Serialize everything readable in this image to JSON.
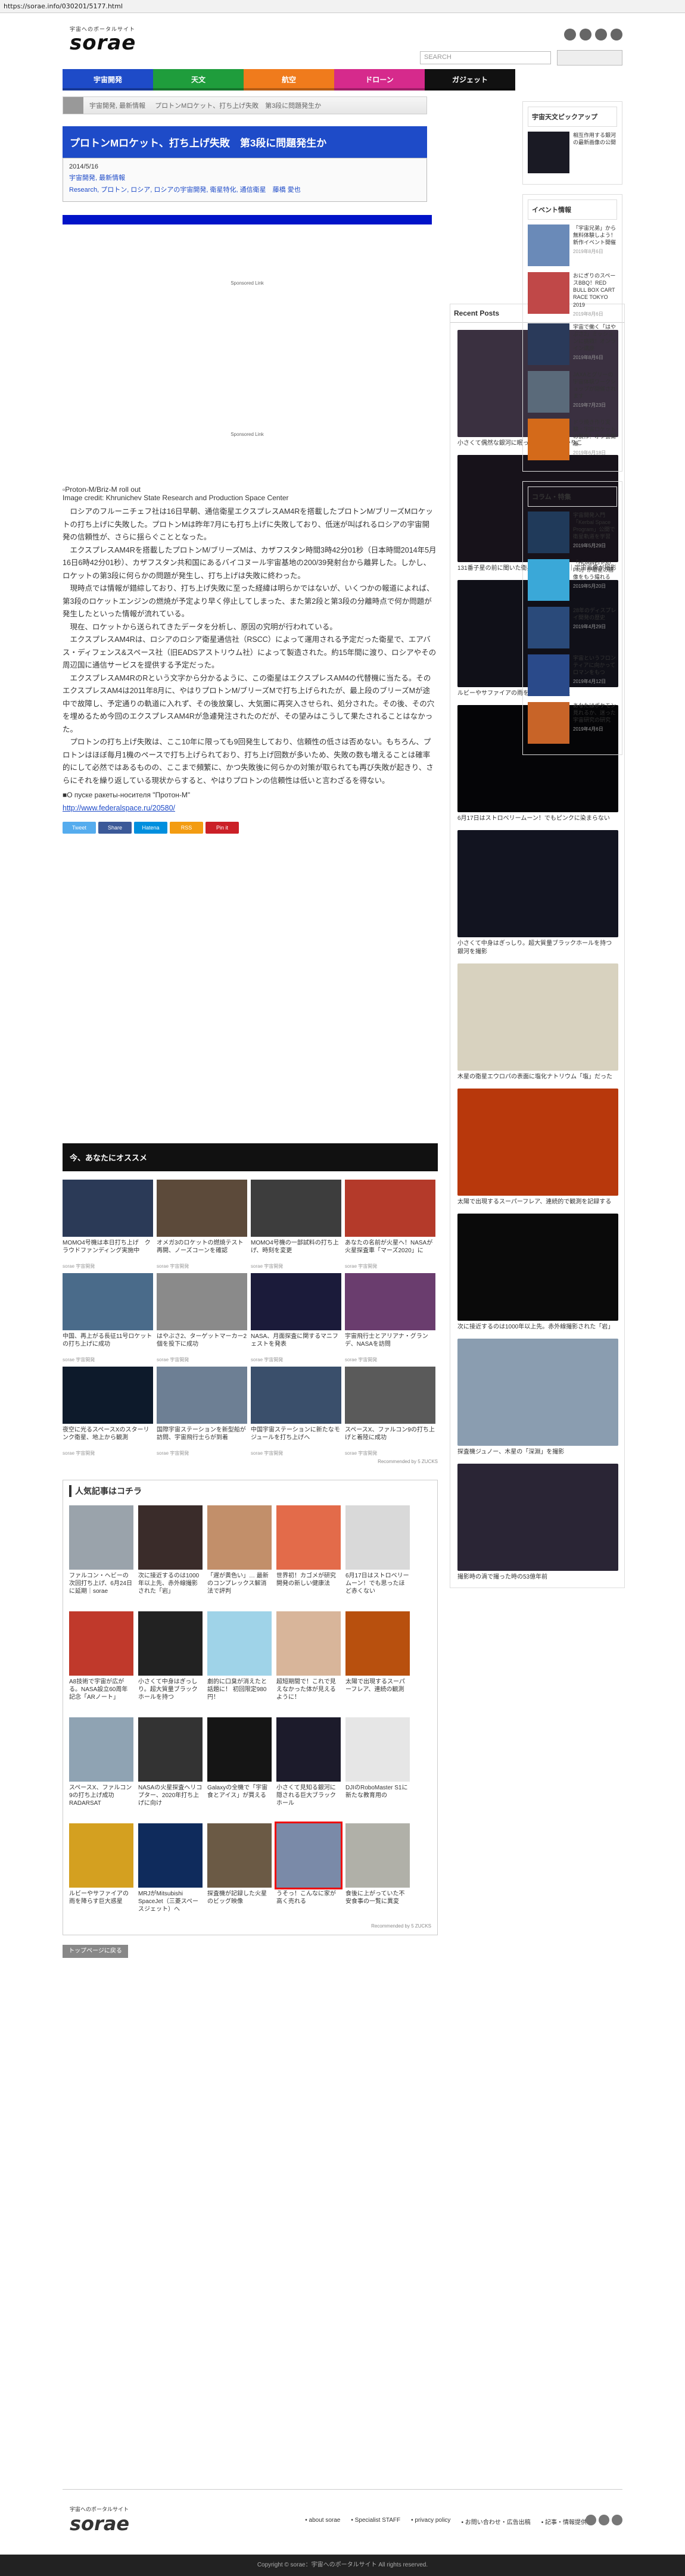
{
  "url": "https://sorae.info/030201/5177.html",
  "header": {
    "logo_sub": "宇宙へのポータルサイト",
    "logo": "sorae",
    "search_placeholder": "SEARCH"
  },
  "nav": [
    {
      "label": "宇宙開発",
      "color": "#1e4bc8"
    },
    {
      "label": "天文",
      "color": "#1f9d3c"
    },
    {
      "label": "航空",
      "color": "#f07b1c"
    },
    {
      "label": "ドローン",
      "color": "#d62a8c"
    },
    {
      "label": "ガジェット",
      "color": "#111111"
    }
  ],
  "breadcrumb": [
    "宇宙開発, 最新情報",
    "プロトンMロケット、打ち上げ失敗　第3段に問題発生か"
  ],
  "article": {
    "title": "プロトンMロケット、打ち上げ失敗　第3段に問題発生か",
    "date": "2014/5/16",
    "category_label": "",
    "categories": "宇宙開発, 最新情報",
    "tags": "Research, プロトン, ロシア, ロシアの宇宙開発, 衛星特化, 通信衛星",
    "author": "藤橋 愛也",
    "sponsored": "Sponsored Link",
    "image_alt": "Proton-M/Briz-M roll out",
    "credit": "Image credit: Khrunichev State Research and Production Space Center",
    "paragraphs": [
      "ロシアのフルーニチェフ社は16日早朝、通信衛星エクスプレスAM4Rを搭載したプロトンM/ブリーズMロケットの打ち上げに失敗した。プロトンMは昨年7月にも打ち上げに失敗しており、低迷が叫ばれるロシアの宇宙開発の信頼性が、さらに揺らぐこととなった。",
      "エクスプレスAM4Rを搭載したプロトンM/ブリーズMは、カザフスタン時間3時42分01秒（日本時間2014年5月16日6時42分01秒）、カザフスタン共和国にあるバイコヌール宇宙基地の200/39発射台から離昇した。しかし、ロケットの第3段に何らかの問題が発生し、打ち上げは失敗に終わった。",
      "現時点では情報が錯綜しており、打ち上げ失敗に至った経緯は明らかではないが、いくつかの報道によれば、第3段のロケットエンジンの燃焼が予定より早く停止してしまった、また第2段と第3段の分離時点で何か問題が発生したといった情報が流れている。",
      "現在、ロケットから送られてきたデータを分析し、原因の究明が行われている。",
      "エクスプレスAM4Rは、ロシアのロシア衛星通信社（RSCC）によって運用される予定だった衛星で、エアバス・ディフェンス&スペース社（旧EADSアストリウム社）によって製造された。約15年間に渡り、ロシアやその周辺国に通信サービスを提供する予定だった。",
      "エクスプレスAM4RのRという文字から分かるように、この衛星はエクスプレスAM4の代替機に当たる。そのエクスプレスAM4は2011年8月に、やはりプロトンM/ブリーズMで打ち上げられたが、最上段のブリーズMが途中で故障し、予定通りの軌道に入れず、その後放棄し、大気圏に再突入させられ、処分された。その後、その穴を埋めるため今回のエクスプレスAM4Rが急遽発注されたのだが、その望みはこうして果たされることはなかった。",
      "プロトンの打ち上げ失敗は、ここ10年に限っても9回発生しており、信頼性の低さは否めない。もちろん、プロトンはほぼ毎月1機のペースで打ち上げられており、打ち上げ回数が多いため、失敗の数も増えることは確率的にして必然ではあるものの、ここまで頻繁に、かつ失敗後に何らかの対策が取られても再び失敗が起きり、さらにそれを繰り返している現状からすると、やはりプロトンの信頼性は低いと言わざるを得ない。"
    ],
    "russian_line": "■О пуске ракеты-носителя \"Протон-М\"",
    "source_url": "http://www.federalspace.ru/20580/"
  },
  "share": [
    {
      "label": "Tweet",
      "color": "#55acee"
    },
    {
      "label": "Share",
      "color": "#3b5998"
    },
    {
      "label": "Hatena",
      "color": "#008fde"
    },
    {
      "label": "RSS",
      "color": "#f39c12"
    },
    {
      "label": "Pin it",
      "color": "#cb2027"
    }
  ],
  "recommend": {
    "heading": "今、あなたにオススメ",
    "items": [
      {
        "title": "MOMO4号機は本日打ち上げ　クラウドファンディング実施中",
        "src": "sorae 宇宙開発",
        "color": "#2b3a57"
      },
      {
        "title": "オメガ3のロケットの燃焼テスト再開、ノーズコーンを確認",
        "src": "sorae 宇宙開発",
        "color": "#5c4a3a"
      },
      {
        "title": "MOMO4号機の一部試料の打ち上げ、時刻を変更",
        "src": "sorae 宇宙開発",
        "color": "#3d3d3d"
      },
      {
        "title": "あなたの名前が火星へ！NASAが火星探査車「マーズ2020」に",
        "src": "sorae 宇宙開発",
        "color": "#b43a2a"
      },
      {
        "title": "中国、再上がる長征11号ロケットの打ち上げに成功",
        "src": "sorae 宇宙開発",
        "color": "#4a6b8a"
      },
      {
        "title": "はやぶさ2、ターゲットマーカー2個を投下に成功",
        "src": "sorae 宇宙開発",
        "color": "#8a8a8a"
      },
      {
        "title": "NASA、月面探査に関するマニフェストを発表",
        "src": "sorae 宇宙開発",
        "color": "#1b1b3a"
      },
      {
        "title": "宇宙飛行士とアリアナ・グランデ、NASAを訪問",
        "src": "sorae 宇宙開発",
        "color": "#6a3d6e"
      },
      {
        "title": "夜空に光るスペースXのスターリンク衛星、地上から観測",
        "src": "sorae 宇宙開発",
        "color": "#0d1a2b"
      },
      {
        "title": "国際宇宙ステーションを新型船が訪問、宇宙飛行士らが到着",
        "src": "sorae 宇宙開発",
        "color": "#6d7f94"
      },
      {
        "title": "中国宇宙ステーションに新たなモジュールを打ち上げへ",
        "src": "sorae 宇宙開発",
        "color": "#3a4f6b"
      },
      {
        "title": "スペースX、ファルコン9の打ち上げと着陸に成功",
        "src": "sorae 宇宙開発",
        "color": "#5a5a5a"
      }
    ],
    "powered": "Recommended by 5 ZUCKS"
  },
  "popular": {
    "heading": "人気記事はコチラ",
    "items": [
      {
        "title": "ファルコン・ヘビーの次回打ち上げ、6月24日に延期｜sorae",
        "color": "#9aa3ab"
      },
      {
        "title": "次に接近するのは1000年以上先、赤外線撮影された「岩」",
        "color": "#3a2c2a"
      },
      {
        "title": "「遅が黄色い」… 最新のコンプレックス解消法で評判",
        "color": "#c28f6a"
      },
      {
        "title": "世界初！カゴメが研究開発の新しい健康法",
        "color": "#e36b4a"
      },
      {
        "title": "6月17日はストロベリームーン！でも思ったほど赤くない",
        "color": "#d9d9d9"
      },
      {
        "title": "A8技術で宇宙が広がる。NASA設立60周年記念「ARノート」",
        "color": "#c0392b"
      },
      {
        "title": "小さくて中身はぎっしり。超大質量ブラックホールを持つ",
        "color": "#222222"
      },
      {
        "title": "劇的に口臭が消えたと話題に！ 初回限定980円！",
        "color": "#9fd3e8"
      },
      {
        "title": "超短期間で！これで見えなかった体が見えるように！",
        "color": "#d8b59a"
      },
      {
        "title": "太陽で出現するスーパーフレア、連続の観測",
        "color": "#b8500e"
      },
      {
        "title": "スペースX、ファルコン9の打ち上げ成功 RADARSAT",
        "color": "#8fa3b3"
      },
      {
        "title": "NASAの火星探査ヘリコプター、2020年打ち上げに向け",
        "color": "#333333"
      },
      {
        "title": "Galaxyの全機で「宇宙食とアイス」が買える",
        "color": "#151515"
      },
      {
        "title": "小さくて見知る銀河に隠される巨大ブラックホール",
        "color": "#1c1b2b"
      },
      {
        "title": "DJIのRoboMaster S1に新たな教育用の",
        "color": "#e6e6e6"
      },
      {
        "title": "ルビーやサファイアの雨を降らす巨大惑星",
        "color": "#d4a020"
      },
      {
        "title": "MRJがMitsubishi SpaceJet（三菱スペースジェット）へ",
        "color": "#0f2b5c"
      },
      {
        "title": "探査機が記録した火星のビッグ映像",
        "color": "#6b5a45"
      },
      {
        "title": "うそっ！こんなに家が高く売れる",
        "color": "#7a8aa8",
        "highlight": true
      },
      {
        "title": "食後に上がっていた不安食事の一覧に異変",
        "color": "#b0b0a8"
      }
    ],
    "powered": "Recommended by 5 ZUCKS"
  },
  "back_to_top": "トップページに戻る",
  "recent": {
    "heading": "Recent Posts",
    "items": [
      {
        "title": "小さくて偶然な銀河に眠った月並みのひかりこ",
        "color": "#3a3040"
      },
      {
        "title": "131番子星の前に聞いた衛星の合成モデル｜宇宙画像が撮影",
        "color": "#17121a"
      },
      {
        "title": "ルビーやサファイアの雨を降らす巨大惑星",
        "color": "#101018"
      },
      {
        "title": "6月17日はストロベリームーン！でもピンクに染まらない",
        "color": "#050507"
      },
      {
        "title": "小さくて中身はぎっしり。超大質量ブラックホールを持つ銀河を撮影",
        "color": "#121420"
      },
      {
        "title": "木星の衛星エウロパの表面に塩化ナトリウム「塩」だった",
        "color": "#d8d2bf"
      },
      {
        "title": "太陽で出現するスーパーフレア、連続的で観測を記録する",
        "color": "#b8380c"
      },
      {
        "title": "次に接近するのは1000年以上先。赤外線撮影された「岩」",
        "color": "#0a0a0a"
      },
      {
        "title": "探査機ジュノー、木星の「深淵」を撮影",
        "color": "#8a9db0"
      },
      {
        "title": "撮影時の渦で撮った時の53億年前",
        "color": "#2a2535"
      }
    ]
  },
  "sidebar": {
    "pickup": {
      "heading": "宇宙天文ピックアップ",
      "items": [
        {
          "title": "相互作用する銀河の最新画像の公開",
          "date": "",
          "color": "#1a1a24"
        }
      ]
    },
    "events": {
      "heading": "イベント情報",
      "items": [
        {
          "title": "「宇宙兄弟」から無料体験しよう！新作イベント開催",
          "date": "2019年8月6日",
          "color": "#6a8ab8"
        },
        {
          "title": "おにぎりのスペースBBQ！RED BULL BOX CART RACE TOKYO 2019",
          "date": "2019年8月6日",
          "color": "#c04848"
        },
        {
          "title": "宇宙で働く「はやぶさ2」ミッションに挑戦！オンライン講座",
          "date": "2019年8月6日",
          "color": "#2a3a5a"
        },
        {
          "title": "JAXAとグリーの宇宙体験ワークショップが開催されます",
          "date": "2019年7月23日",
          "color": "#5a6a7a"
        },
        {
          "title": "ドラ焼き作り実験・宇宙ロケットの製作！オフ会開催",
          "date": "2019年6月18日",
          "color": "#d46a1a"
        }
      ]
    },
    "column": {
      "heading": "コラム・特集",
      "items": [
        {
          "title": "宇宙開発入門「Kerbal Space Program」公開で衛星軌道を学習",
          "date": "2019年5月29日",
          "color": "#203a5a"
        },
        {
          "title": "「HUAWEI P30 Pro」が衛星の画像をもう撮れる",
          "date": "2019年5月20日",
          "color": "#3aa8d8"
        },
        {
          "title": "28年のディスプレイ開発の歴史",
          "date": "2019年4月29日",
          "color": "#2a4a7a"
        },
        {
          "title": "宇宙というフロンティアに向かってロマンをもつ",
          "date": "2019年4月12日",
          "color": "#2a4a8a"
        },
        {
          "title": "あなたはポケモン見れるか、迷った宇宙研究の研究",
          "date": "2019年4月6日",
          "color": "#c86428"
        }
      ]
    }
  },
  "footer": {
    "logo_sub": "宇宙へのポータルサイト",
    "logo": "sorae",
    "links": [
      "about sorae",
      "Specialist STAFF",
      "privacy policy",
      "お問い合わせ・広告出稿",
      "記事・情報提供"
    ],
    "copyright": "Copyright © sorae：宇宙へのポータルサイト All rights reserved."
  }
}
